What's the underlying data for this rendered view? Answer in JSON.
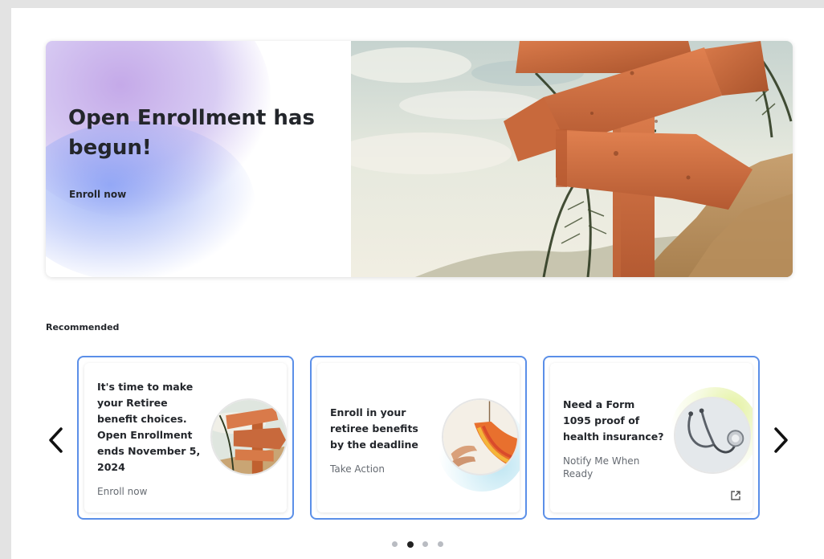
{
  "hero": {
    "title": "Open Enrollment has begun!",
    "link_label": "Enroll now"
  },
  "recommended": {
    "label": "Recommended",
    "cards": [
      {
        "title": "It's time to make your Retiree benefit choices. Open Enrollment ends November 5, 2024",
        "action": "Enroll now",
        "thumb_icon": "signpost-image"
      },
      {
        "title": "Enroll in your retiree benefits by the deadline",
        "action": "Take Action",
        "thumb_icon": "hammock-image"
      },
      {
        "title": "Need a Form 1095 proof of health insurance?",
        "action": "Notify Me When Ready",
        "thumb_icon": "stethoscope-image",
        "trailing_icon": "external-link-icon"
      }
    ],
    "pagination": {
      "total": 4,
      "active": 1
    }
  },
  "colors": {
    "card_border": "#5b8fe8",
    "text": "#23262b"
  }
}
